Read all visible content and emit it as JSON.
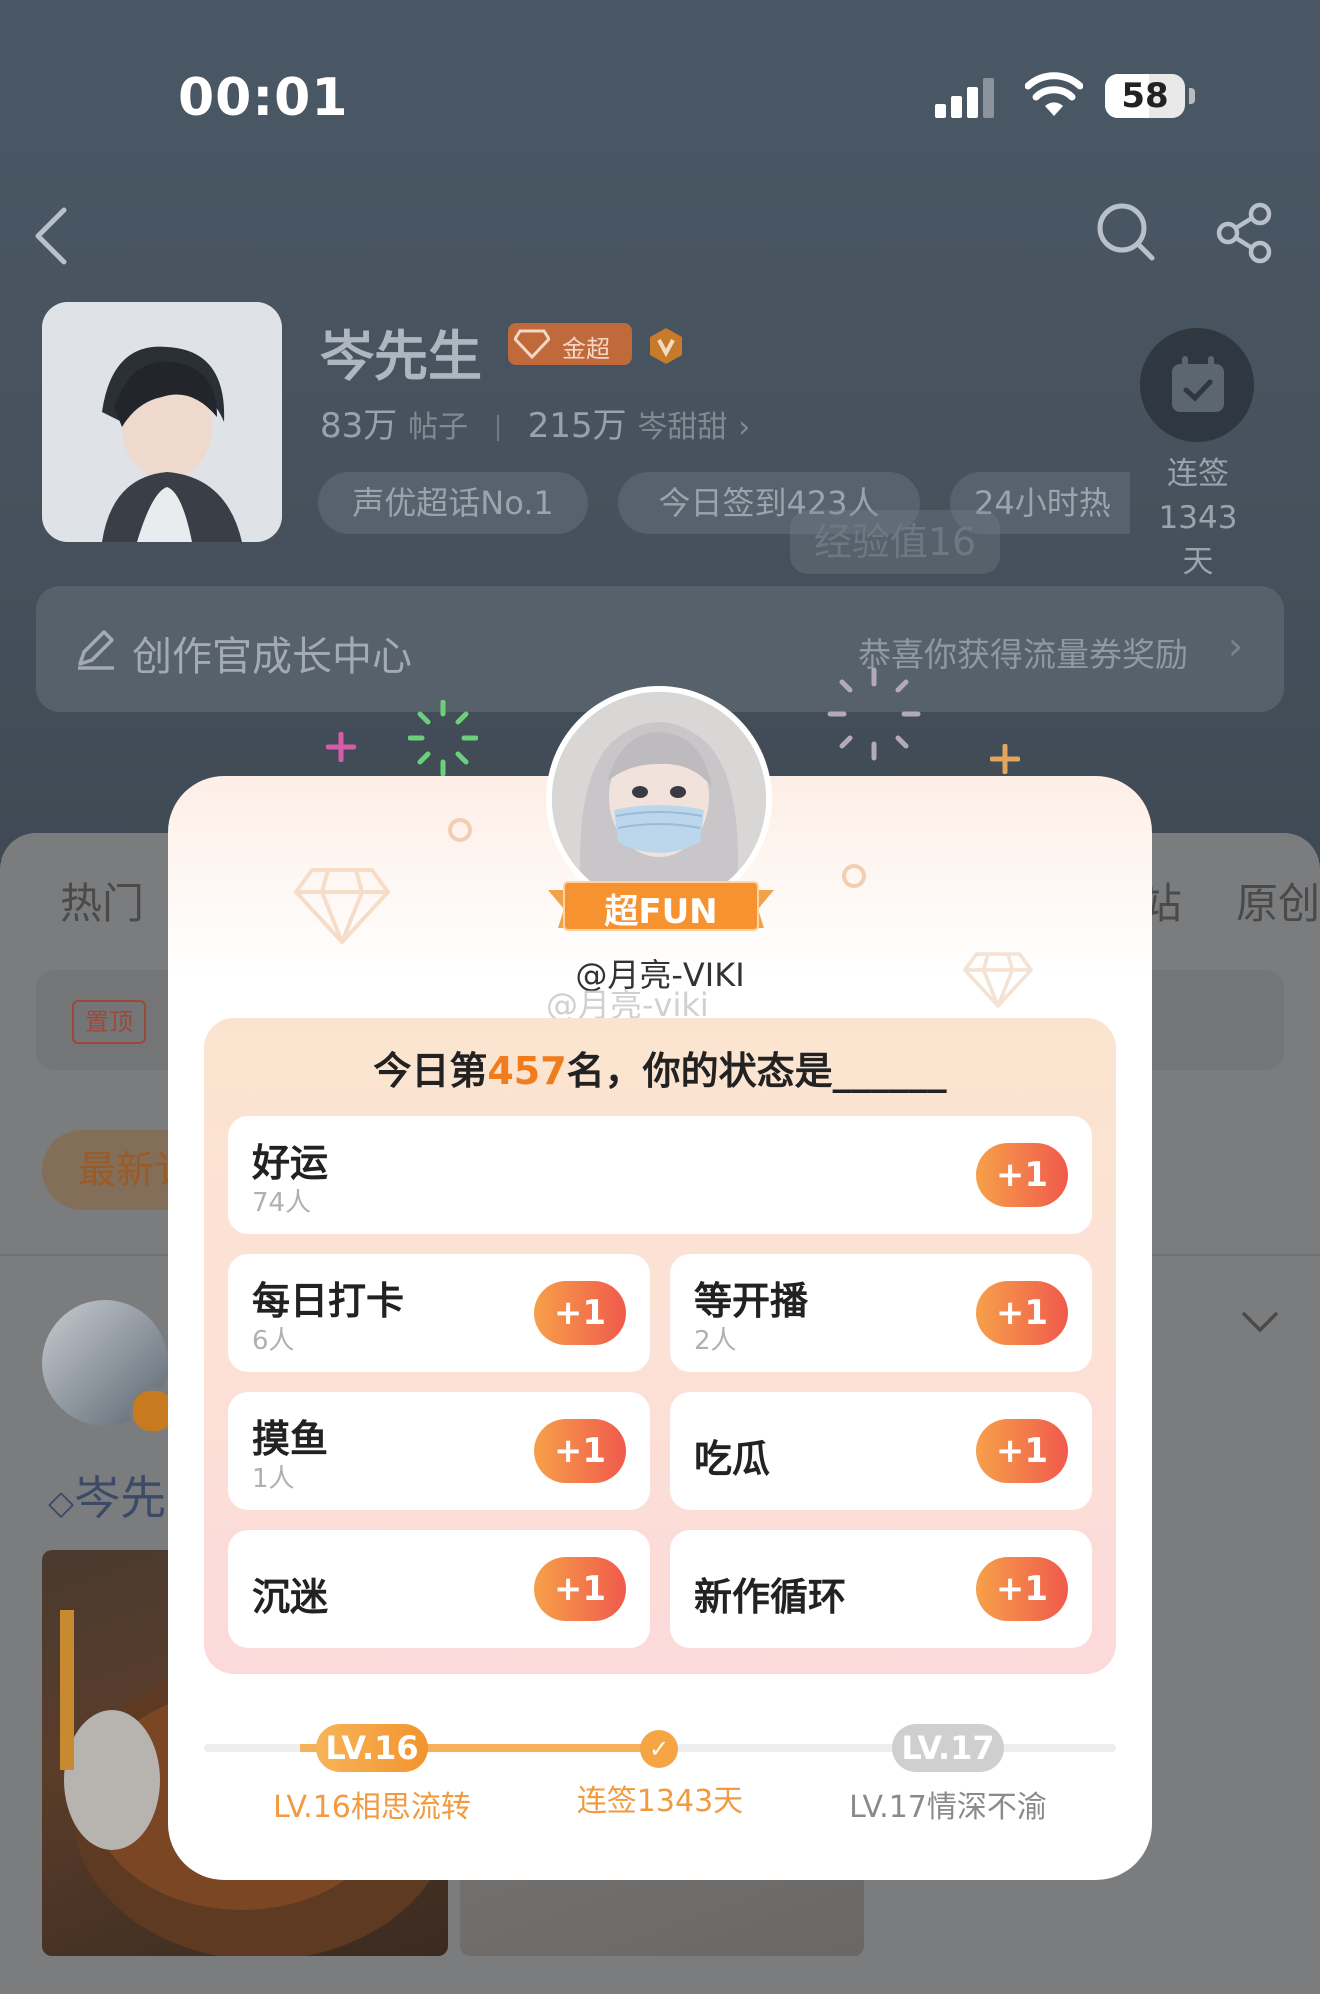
{
  "status_bar": {
    "time": "00:01",
    "battery": "58"
  },
  "topic": {
    "name": "岑先生",
    "badge": "金超",
    "stats": {
      "posts_count": "83万",
      "posts_label": "帖子",
      "fans_count": "215万",
      "fans_label": "岑甜甜"
    },
    "tags": [
      "声优超话No.1",
      "今日签到423人",
      "24小时热"
    ],
    "sign_label": "连签",
    "sign_days": "1343天",
    "exp_toast": "经验值16"
  },
  "growth_center": {
    "title": "创作官成长中心",
    "reward": "恭喜你获得流量券奖励"
  },
  "tabs": {
    "left": "热门",
    "right1": "站",
    "right2": "原创"
  },
  "feed": {
    "pin_label": "置顶",
    "newest_label": "最新讠",
    "author_partial": "岑先"
  },
  "popup": {
    "ribbon": "超FUN",
    "username": "@月亮-VIKI",
    "watermark": "@月亮-viki",
    "question_prefix": "今日第",
    "rank": "457",
    "question_suffix": "名，你的状态是______",
    "options": [
      {
        "label": "好运",
        "count": "74人",
        "button": "+1"
      },
      {
        "label": "每日打卡",
        "count": "6人",
        "button": "+1"
      },
      {
        "label": "等开播",
        "count": "2人",
        "button": "+1"
      },
      {
        "label": "摸鱼",
        "count": "1人",
        "button": "+1"
      },
      {
        "label": "吃瓜",
        "count": "",
        "button": "+1"
      },
      {
        "label": "沉迷",
        "count": "",
        "button": "+1"
      },
      {
        "label": "新作循环",
        "count": "",
        "button": "+1"
      }
    ],
    "progress": {
      "current_level": "LV.16",
      "current_caption": "LV.16相思流转",
      "streak_caption": "连签1343天",
      "next_level": "LV.17",
      "next_caption": "LV.17情深不渝"
    }
  },
  "colors": {
    "accent_orange": "#f07c1e",
    "button_start": "#f6a04a",
    "button_end": "#f05a4c"
  }
}
